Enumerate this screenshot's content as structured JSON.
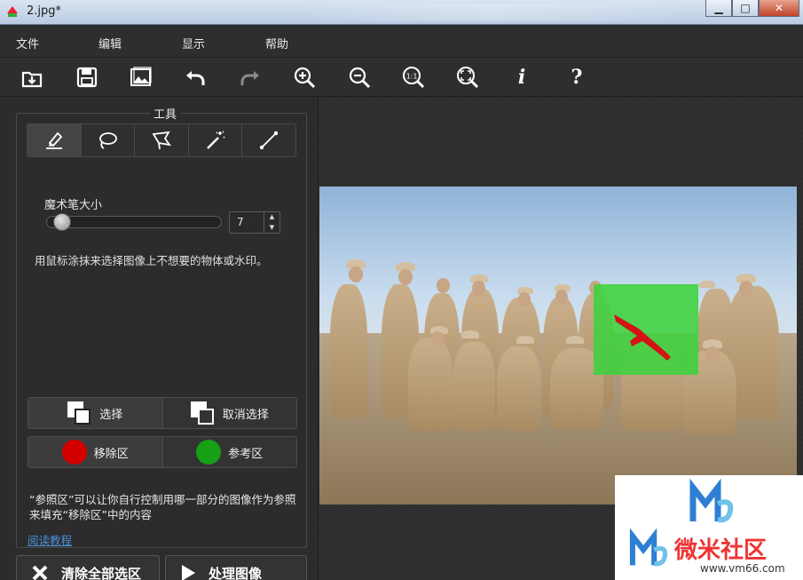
{
  "window": {
    "title": "2.jpg*"
  },
  "menu": {
    "items": [
      "文件",
      "编辑",
      "显示",
      "帮助"
    ]
  },
  "toolbar": {
    "info_label": "i",
    "help_label": "?",
    "zoom_actual_label": "1:1"
  },
  "tools": {
    "group_title": "工具",
    "brush_size_label": "魔术笔大小",
    "brush_size_value": "7",
    "brush_size_fraction": 0.05,
    "hint": "用鼠标涂抹来选择图像上不想要的物体或水印。",
    "select_label": "选择",
    "deselect_label": "取消选择",
    "remove_area_label": "移除区",
    "reference_area_label": "参考区",
    "reference_note": "“参照区”可以让你自行控制用哪一部分的图像作为参照来填充“移除区”中的内容",
    "read_tutorial_label": "阅读教程",
    "clear_all_label": "清除全部选区",
    "process_label": "处理图像"
  },
  "watermark": {
    "brand": "微米社区",
    "url": "www.vm66.com"
  },
  "colors": {
    "remove": "#d40000",
    "reference": "#16a016",
    "selection": "#3ed13e"
  }
}
